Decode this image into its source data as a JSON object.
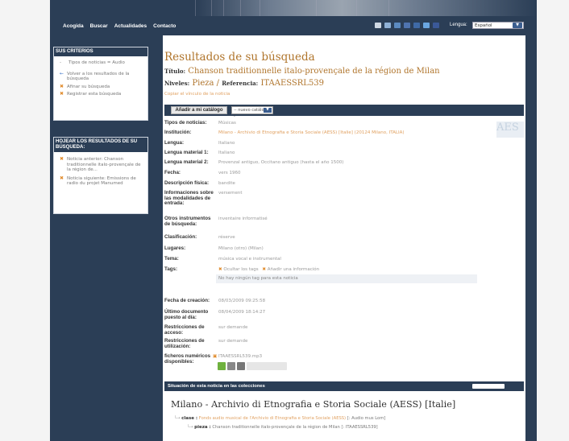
{
  "topnav": {
    "links": [
      "Acogida",
      "Buscar",
      "Actualidades",
      "Contacto"
    ],
    "language_label": "Lengua:",
    "language_value": "Español",
    "icons": [
      "mail-icon",
      "rss-icon",
      "share-icon",
      "myspace-icon",
      "delicious-icon",
      "digg-icon",
      "facebook-icon"
    ]
  },
  "sidebar": {
    "criteria": {
      "header": "SUS CRITERIOS",
      "query": "Tipos de noticias = Audio",
      "back": "Volver a los resultados de la búsqueda",
      "refine": "Afinar su búsqueda",
      "save": "Registrar esta búsqueda"
    },
    "browse": {
      "header": "HOJEAR LOS RESULTADOS DE SU BÚSQUEDA:",
      "prev": "Noticia anterior: Chanson traditionnelle italo-provençale de la région de...",
      "next": "Noticia siguiente: Emissions de radio du projet Manumed"
    }
  },
  "main": {
    "title": "Resultados de su búsqueda",
    "titulo_label": "Título:",
    "titulo_value": "Chanson traditionnelle italo-provençale de la région de Milan",
    "niveles_label": "Niveles:",
    "niveles_value": "Pieza",
    "sep": "/",
    "referencia_label": "Referencia:",
    "referencia_value": "ITAAESSRL539",
    "copy_link": "Copiar el vínculo de la noticia",
    "add_button": "Añadir a mi catálogo",
    "catalog_select": "-- nuevo catálogo --",
    "logo_text": "AES",
    "fields": [
      {
        "label": "Tipos de noticias:",
        "value": "Músicas",
        "orange": false
      },
      {
        "label": "Institución:",
        "value": "Milano - Archivio di Etnografia e Storia Sociale (AESS) [Italie] (20124 Milano, ITALIA)",
        "orange": true
      },
      {
        "label": "Lengua:",
        "value": "Italiano",
        "orange": false
      },
      {
        "label": "Lengua material 1:",
        "value": "Italiano",
        "orange": false
      },
      {
        "label": "Lengua material 2:",
        "value": "Provenzal antiguo, Occitano antiguo (hasta el año 1500)",
        "orange": false
      },
      {
        "label": "Fecha:",
        "value": "vers 1960",
        "orange": false
      },
      {
        "label": "Descripción física:",
        "value": "bandite",
        "orange": false
      },
      {
        "label": "Informaciones sobre las modalidades de entrada:",
        "value": "versement",
        "orange": false
      },
      {
        "label": "Otros instrumentos de búsqueda:",
        "value": "inventaire informatisé",
        "orange": false
      },
      {
        "label": "Clasificación:",
        "value": "réserve",
        "orange": false
      },
      {
        "label": "Lugares:",
        "value": "Milano (otro) (Milan)",
        "orange": false
      },
      {
        "label": "Tema:",
        "value": "música vocal e instrumental",
        "orange": false
      }
    ],
    "tags": {
      "label": "Tags:",
      "hide": "Ocultar los tags",
      "add": "Añadir una información",
      "none": "No hay ningún tag para esta noticia"
    },
    "fields2": [
      {
        "label": "Fecha de creación:",
        "value": "08/03/2009 09:25:58"
      },
      {
        "label": "Último documento puesto al día:",
        "value": "08/04/2009 18:14:27"
      },
      {
        "label": "Restricciones de acceso:",
        "value": "sur demande"
      },
      {
        "label": "Restricciones de utilización:",
        "value": "sur demande"
      },
      {
        "label": "ficheros numéricos disponibles:",
        "value": "ITAAESSRL539.mp3"
      }
    ]
  },
  "collections": {
    "header": "Situación de esta noticia en las colecciones",
    "title": "Milano - Archivio di Etnografia e Storia Sociale (AESS) [Italie]",
    "l1_label": "clase :",
    "l1_value": "Fonds audio musical de l'Archivio di Etnografia e Storia Sociale (AESS)",
    "l1_suffix": "[: Audio mus Lom]",
    "l2_label": "pieza :",
    "l2_value": "Chanson traditionnelle italo-provençale de la région de Milan [: ITAAESSRL539]"
  },
  "colors": {
    "nav": "#2b3e56",
    "accent": "#b0752c",
    "link": "#e0a060"
  }
}
